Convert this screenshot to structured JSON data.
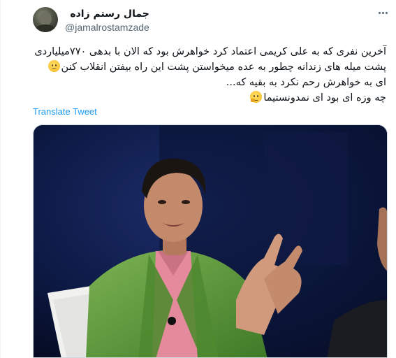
{
  "user": {
    "display_name": "جمال رستم زاده",
    "handle": "@jamalrostamzade",
    "avatar_icon": "profile-photo"
  },
  "tweet": {
    "lines": [
      "آخرین نفری که به علی کریمی اعتماد کرد خواهرش بود که الان با بدهی ۷۷۰میلیاردی",
      "پشت میله های زندانه چطور به عده میخواستن پشت این راه بیفتن انقلاب کنن",
      "ای به خواهرش رحم نکرد به بقیه که...",
      "چه وزه ای بود ای نمدونستیما"
    ],
    "emoji_1": "worried-face",
    "emoji_2": "thinking-face"
  },
  "actions": {
    "translate_label": "Translate Tweet",
    "more_icon": "more-horizontal-icon"
  },
  "media": {
    "description_icon": "photo",
    "colors": {
      "background": "#0b1536",
      "jacket": "#5e9a3c",
      "shirt": "#e58a9c"
    }
  },
  "colors": {
    "link": "#1d9bf0",
    "secondary_text": "#536471",
    "text": "#0f1419"
  }
}
